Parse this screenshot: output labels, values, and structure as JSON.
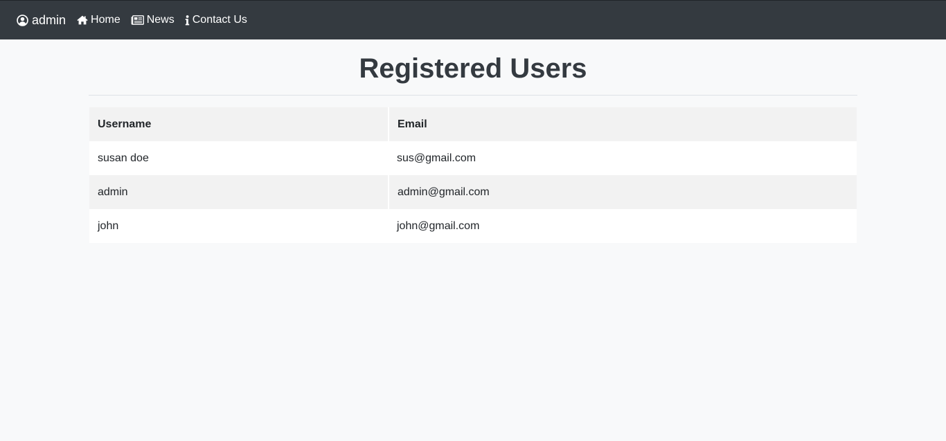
{
  "navbar": {
    "brand": {
      "label": "admin",
      "icon": "user-circle-icon"
    },
    "links": [
      {
        "label": "Home",
        "icon": "home-icon"
      },
      {
        "label": "News",
        "icon": "newspaper-icon"
      },
      {
        "label": "Contact Us",
        "icon": "info-icon"
      }
    ]
  },
  "page": {
    "title": "Registered Users"
  },
  "table": {
    "headers": [
      "Username",
      "Email"
    ],
    "rows": [
      {
        "username": "susan doe",
        "email": "sus@gmail.com"
      },
      {
        "username": "admin",
        "email": "admin@gmail.com"
      },
      {
        "username": "john",
        "email": "john@gmail.com"
      }
    ]
  },
  "colors": {
    "navbar_bg": "#343a40",
    "page_bg": "#f8f9fa",
    "header_bg": "#f2f2f2",
    "text": "#343a40"
  }
}
